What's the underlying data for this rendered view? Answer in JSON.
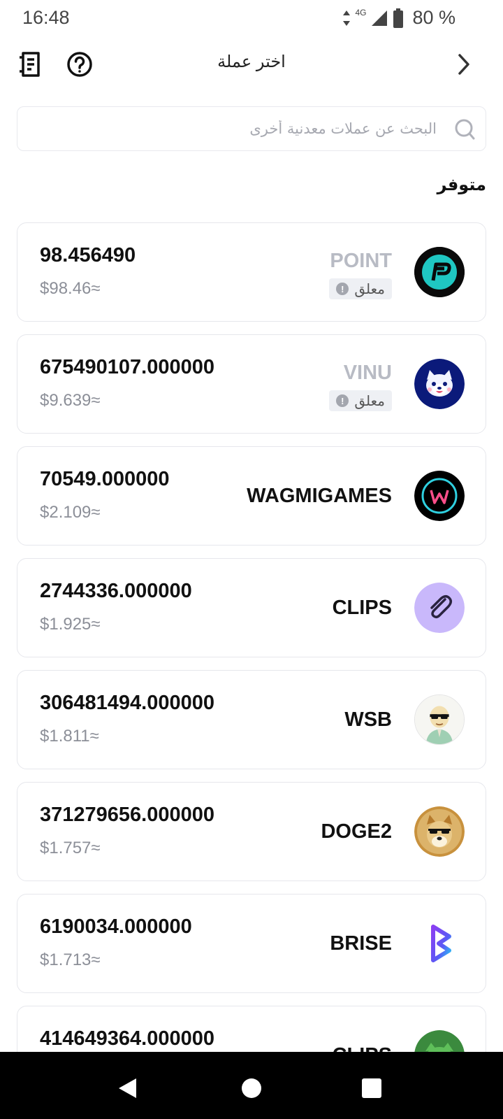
{
  "status_bar": {
    "time": "16:48",
    "network": "4G",
    "battery": "80 %"
  },
  "header": {
    "title": "اختر عملة",
    "icons": [
      "receipt-icon",
      "help-icon",
      "chevron-right-icon"
    ]
  },
  "search": {
    "placeholder": "البحث عن عملات معدنية أخرى",
    "value": ""
  },
  "section_label": "متوفر",
  "tokens": [
    {
      "symbol": "POINT",
      "amount": "98.456490",
      "fiat": "$98.46≈",
      "locked": true,
      "lock_label": "معلق",
      "logo": "point-logo",
      "logo_color": "#1fc7c2"
    },
    {
      "symbol": "VINU",
      "amount": "675490107.000000",
      "fiat": "$9.639≈",
      "locked": true,
      "lock_label": "معلق",
      "logo": "vinu-logo",
      "logo_color": "#0b1a7a"
    },
    {
      "symbol": "WAGMIGAMES",
      "amount": "70549.000000",
      "fiat": "$2.109≈",
      "locked": false,
      "logo": "wagmigames-logo",
      "logo_color": "#000000"
    },
    {
      "symbol": "CLIPS",
      "amount": "2744336.000000",
      "fiat": "$1.925≈",
      "locked": false,
      "logo": "clips-logo",
      "logo_color": "#c9b8fb"
    },
    {
      "symbol": "WSB",
      "amount": "306481494.000000",
      "fiat": "$1.811≈",
      "locked": false,
      "logo": "wsb-logo",
      "logo_color": "#dfeee3"
    },
    {
      "symbol": "DOGE2",
      "amount": "371279656.000000",
      "fiat": "$1.757≈",
      "locked": false,
      "logo": "doge2-logo",
      "logo_color": "#c8913d"
    },
    {
      "symbol": "BRISE",
      "amount": "6190034.000000",
      "fiat": "$1.713≈",
      "locked": false,
      "logo": "brise-logo",
      "logo_color": "#7b3ff2"
    },
    {
      "symbol": "CLIPS",
      "amount": "414649364.000000",
      "fiat": "",
      "locked": false,
      "logo": "frog-logo",
      "logo_color": "#3b8a3e"
    }
  ],
  "nav": [
    "back-icon",
    "home-icon",
    "recents-icon"
  ]
}
